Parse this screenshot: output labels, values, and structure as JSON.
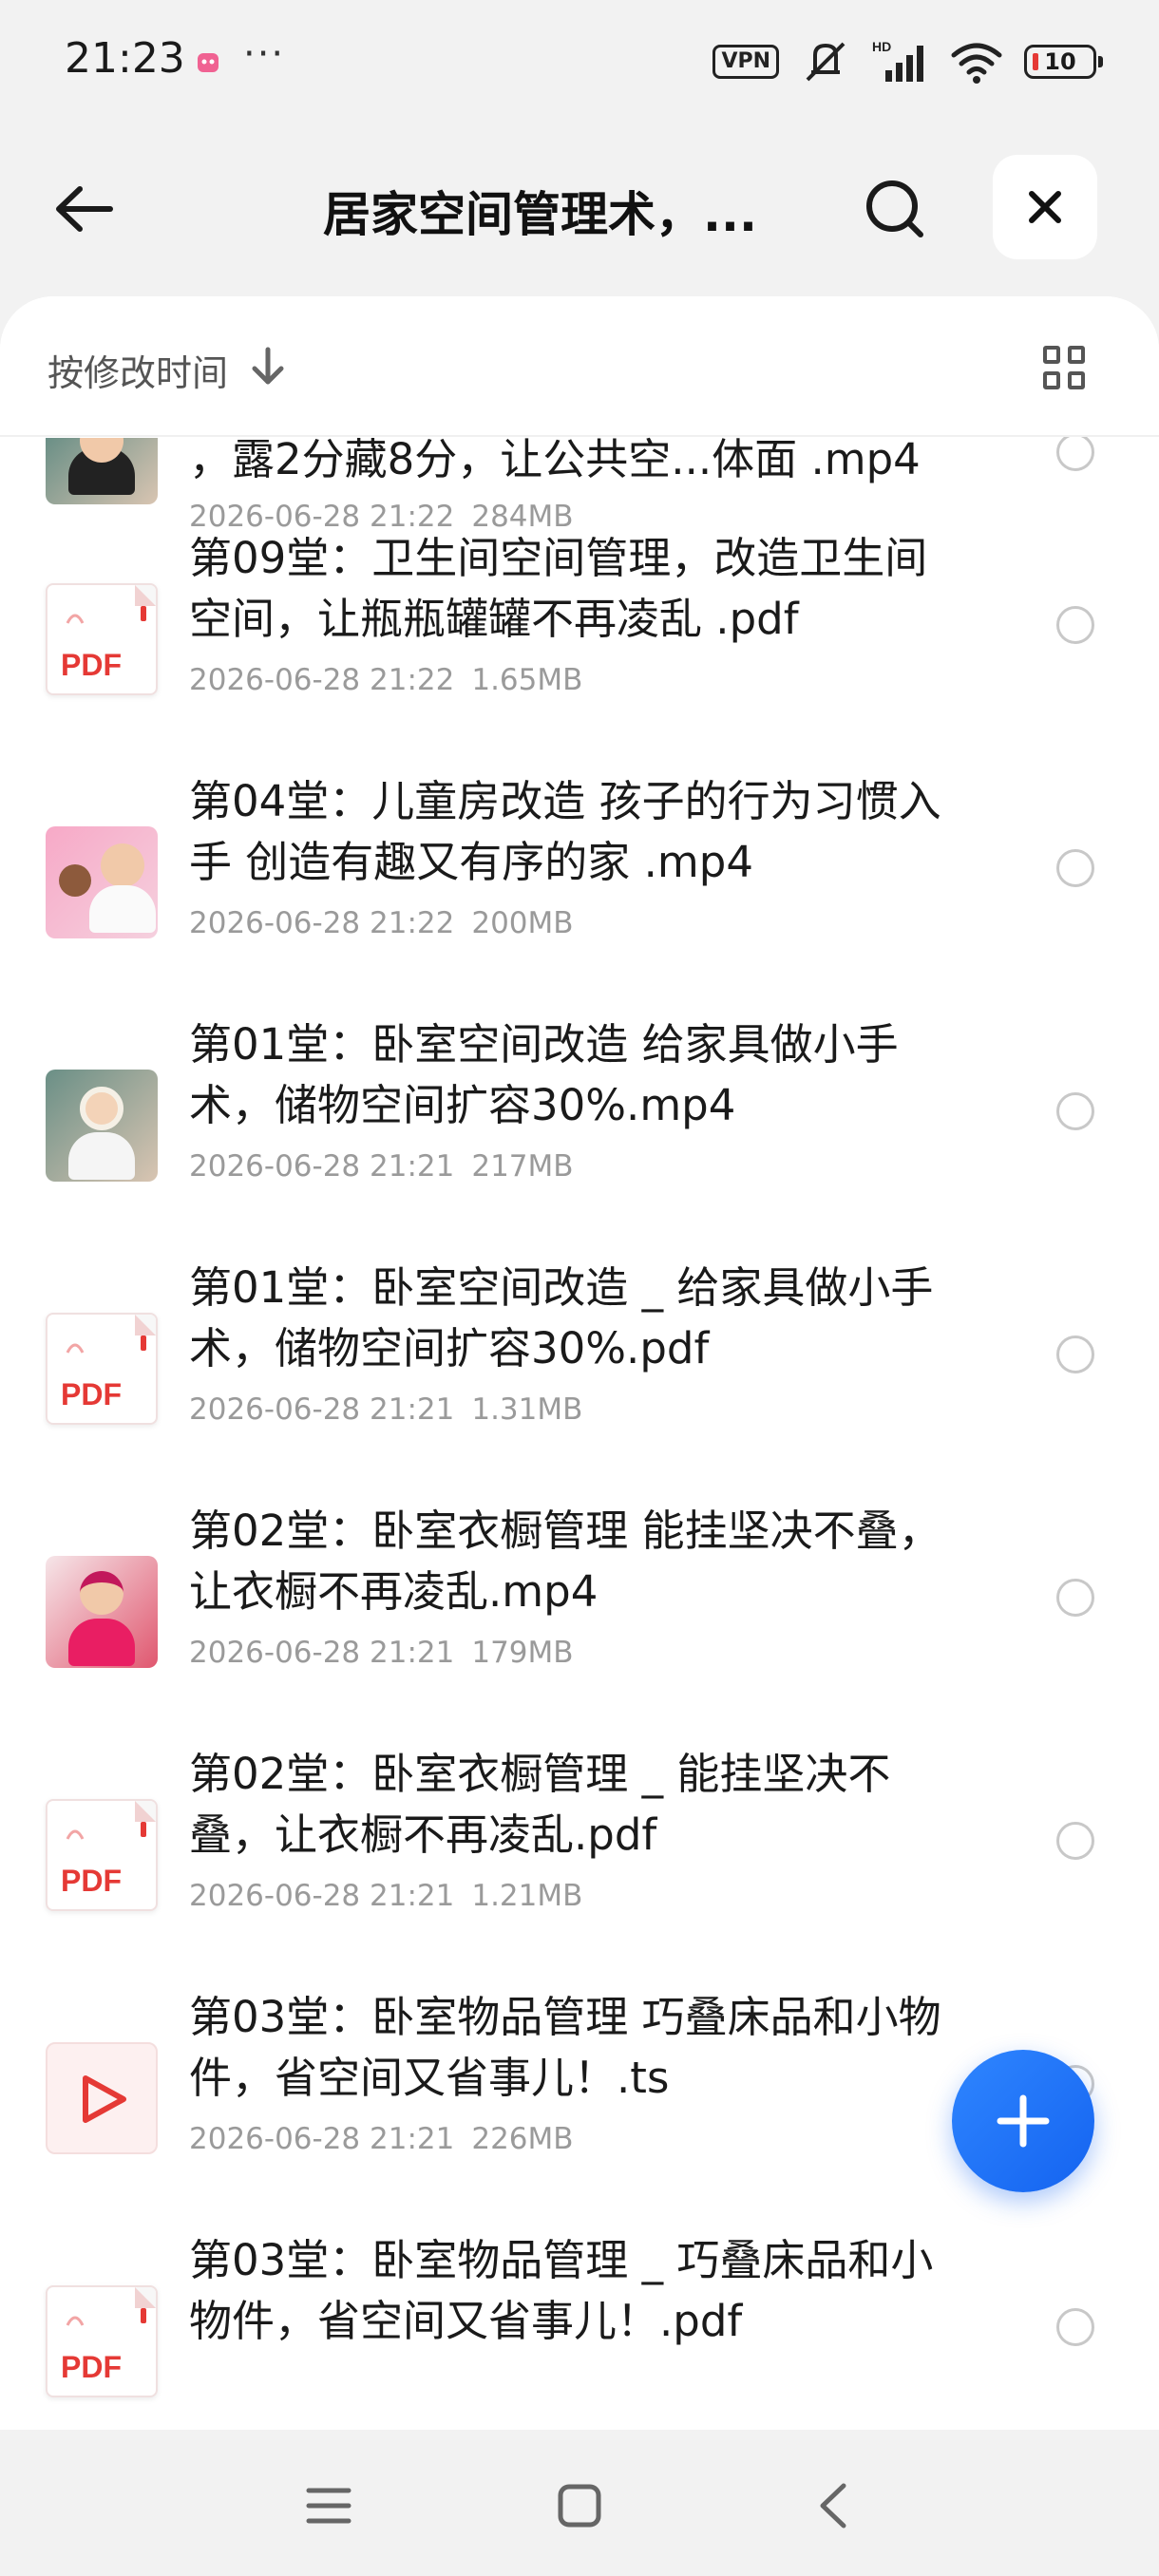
{
  "status_bar": {
    "time": "21:23",
    "dots": "···",
    "vpn": "VPN",
    "battery": "10"
  },
  "header": {
    "title": "居家空间管理术，...",
    "back_icon": "back-arrow-icon",
    "search_icon": "search-icon",
    "close_icon": "close-icon"
  },
  "sort_bar": {
    "label": "按修改时间",
    "arrow_icon": "arrow-down-icon",
    "view_icon": "grid-view-icon"
  },
  "files": [
    {
      "name": "，露2分藏8分，让公共空...体面 .mp4",
      "date": "2026-06-28 21:22",
      "size": "284MB",
      "type": "video",
      "thumb": "dark"
    },
    {
      "name": "第09堂：卫生间空间管理，改造卫生间空间，让瓶瓶罐罐不再凌乱 .pdf",
      "date": "2026-06-28 21:22",
      "size": "1.65MB",
      "type": "pdf",
      "thumb_label": "PDF"
    },
    {
      "name": "第04堂：儿童房改造  孩子的行为习惯入手 创造有趣又有序的家 .mp4",
      "date": "2026-06-28 21:22",
      "size": "200MB",
      "type": "video",
      "thumb": "pink"
    },
    {
      "name": "第01堂：卧室空间改造  给家具做小手术，储物空间扩容30%.mp4",
      "date": "2026-06-28 21:21",
      "size": "217MB",
      "type": "video",
      "thumb": "dark"
    },
    {
      "name": "第01堂：卧室空间改造 _ 给家具做小手术，储物空间扩容30%.pdf",
      "date": "2026-06-28 21:21",
      "size": "1.31MB",
      "type": "pdf",
      "thumb_label": "PDF"
    },
    {
      "name": "第02堂：卧室衣橱管理  能挂坚决不叠，让衣橱不再凌乱.mp4",
      "date": "2026-06-28 21:21",
      "size": "179MB",
      "type": "video",
      "thumb": "red"
    },
    {
      "name": "第02堂：卧室衣橱管理 _ 能挂坚决不叠，让衣橱不再凌乱.pdf",
      "date": "2026-06-28 21:21",
      "size": "1.21MB",
      "type": "pdf",
      "thumb_label": "PDF"
    },
    {
      "name": "第03堂：卧室物品管理  巧叠床品和小物件，省空间又省事儿！.ts",
      "date": "2026-06-28 21:21",
      "size": "226MB",
      "type": "ts"
    },
    {
      "name": "第03堂：卧室物品管理 _ 巧叠床品和小物件，省空间又省事儿！.pdf",
      "date": "",
      "size": "",
      "type": "pdf",
      "thumb_label": "PDF"
    }
  ],
  "fab": {
    "icon": "plus-icon"
  },
  "nav_bar": {
    "menu_icon": "menu-icon",
    "home_icon": "home-icon",
    "back_icon": "back-icon"
  },
  "colors": {
    "accent": "#1463f0",
    "pdf_red": "#e53935",
    "meta_gray": "#9a9a9a"
  }
}
